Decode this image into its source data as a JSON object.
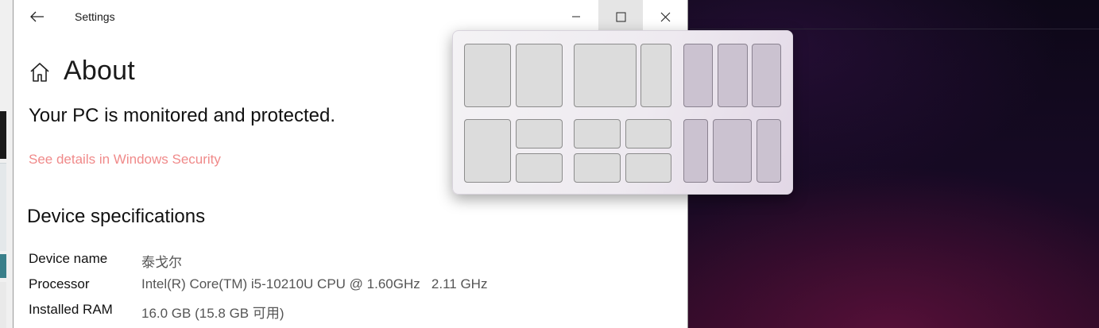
{
  "window": {
    "title": "Settings",
    "back_icon": "arrow-left-icon",
    "controls": [
      "minimize-icon",
      "maximize-icon",
      "close-icon"
    ]
  },
  "page": {
    "title": "About",
    "home_icon": "home-icon"
  },
  "security": {
    "status": "Your PC is monitored and protected.",
    "link": "See details in Windows Security",
    "link_color": "#f08a8a"
  },
  "specs": {
    "heading": "Device specifications",
    "rows": [
      {
        "label": "Device name",
        "value": "泰戈尔"
      },
      {
        "label": "Processor",
        "value": "Intel(R) Core(TM) i5-10210U CPU @ 1.60GHz   2.11 GHz"
      },
      {
        "label": "Installed RAM",
        "value": "16.0 GB (15.8 GB 可用)"
      }
    ]
  },
  "snap_layouts": {
    "layouts": [
      {
        "name": "two-columns-equal",
        "zones": 2
      },
      {
        "name": "two-columns-wide-left",
        "zones": 2
      },
      {
        "name": "three-columns-equal",
        "zones": 3
      },
      {
        "name": "column-plus-two-stacked",
        "zones": 3
      },
      {
        "name": "four-grid",
        "zones": 4
      },
      {
        "name": "three-columns-wide-center",
        "zones": 3
      }
    ]
  }
}
